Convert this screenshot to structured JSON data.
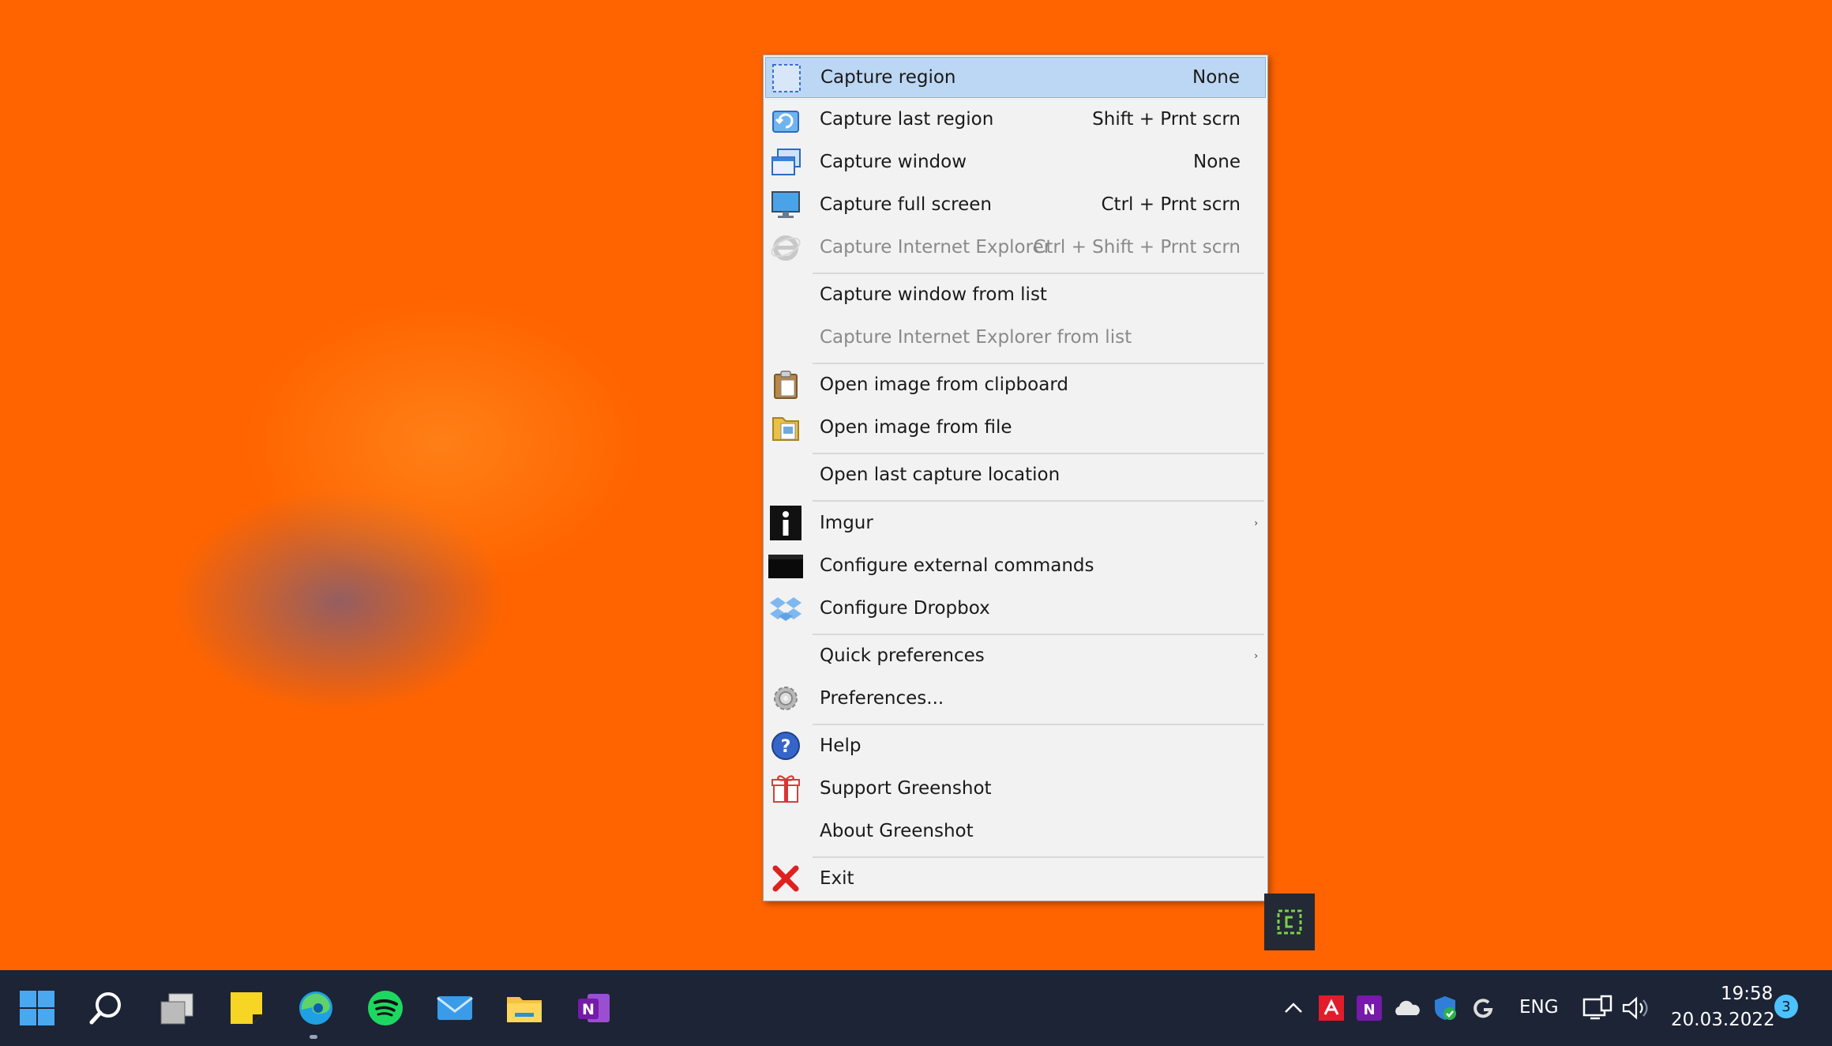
{
  "menu": {
    "items": [
      {
        "label": "Capture region",
        "shortcut": "None",
        "icon": "capture-region-icon"
      },
      {
        "label": "Capture last region",
        "shortcut": "Shift + Prnt scrn",
        "icon": "capture-last-region-icon"
      },
      {
        "label": "Capture window",
        "shortcut": "None",
        "icon": "capture-window-icon"
      },
      {
        "label": "Capture full screen",
        "shortcut": "Ctrl + Prnt scrn",
        "icon": "monitor-icon"
      },
      {
        "label": "Capture Internet Explorer",
        "shortcut": "Ctrl + Shift + Prnt scrn",
        "icon": "internet-explorer-icon"
      },
      {
        "label": "Capture window from list"
      },
      {
        "label": "Capture Internet Explorer from list"
      },
      {
        "label": "Open image from clipboard",
        "icon": "clipboard-icon"
      },
      {
        "label": "Open image from file",
        "icon": "open-file-icon"
      },
      {
        "label": "Open last capture location"
      },
      {
        "label": "Imgur",
        "icon": "imgur-icon"
      },
      {
        "label": "Configure external commands",
        "icon": "terminal-icon"
      },
      {
        "label": "Configure Dropbox",
        "icon": "dropbox-icon"
      },
      {
        "label": "Quick preferences"
      },
      {
        "label": "Preferences...",
        "icon": "gear-icon"
      },
      {
        "label": "Help",
        "icon": "help-icon"
      },
      {
        "label": "Support Greenshot",
        "icon": "gift-icon"
      },
      {
        "label": "About Greenshot"
      },
      {
        "label": "Exit",
        "icon": "close-icon"
      }
    ]
  },
  "taskbar": {
    "apps": [
      "windows-start-icon",
      "search-icon",
      "task-view-icon",
      "sticky-notes-icon",
      "edge-icon",
      "spotify-icon",
      "mail-icon",
      "file-explorer-icon",
      "onenote-icon"
    ],
    "tray": {
      "language": "ENG",
      "time": "19:58",
      "date": "20.03.2022",
      "notifications": "3"
    }
  },
  "colors": {
    "menu_highlight": "#bcd7f3",
    "taskbar": "#1c2436",
    "greenshot_green": "#4caf50",
    "badge": "#4cc2ff"
  }
}
